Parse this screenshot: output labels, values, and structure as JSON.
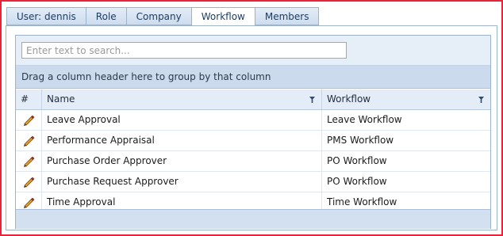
{
  "tabs": [
    {
      "label": "User: dennis",
      "active": false
    },
    {
      "label": "Role",
      "active": false
    },
    {
      "label": "Company",
      "active": false
    },
    {
      "label": "Workflow",
      "active": true
    },
    {
      "label": "Members",
      "active": false
    }
  ],
  "search": {
    "placeholder": "Enter text to search..."
  },
  "group_panel": {
    "text": "Drag a column header here to group by that column"
  },
  "columns": {
    "num": "#",
    "name": "Name",
    "workflow": "Workflow"
  },
  "rows": [
    {
      "name": "Leave Approval",
      "workflow": "Leave Workflow"
    },
    {
      "name": "Performance Appraisal",
      "workflow": "PMS Workflow"
    },
    {
      "name": "Purchase Order Approver",
      "workflow": "PO Workflow"
    },
    {
      "name": "Purchase Request Approver",
      "workflow": "PO Workflow"
    },
    {
      "name": "Time Approval",
      "workflow": "Time Workflow"
    }
  ],
  "colors": {
    "frame_border": "#e8233a",
    "tab_border": "#9db3cc",
    "group_panel_bg": "#cbdaec"
  },
  "icons": {
    "row_action": "pencil-edit-icon",
    "column_filter": "filter-icon"
  }
}
